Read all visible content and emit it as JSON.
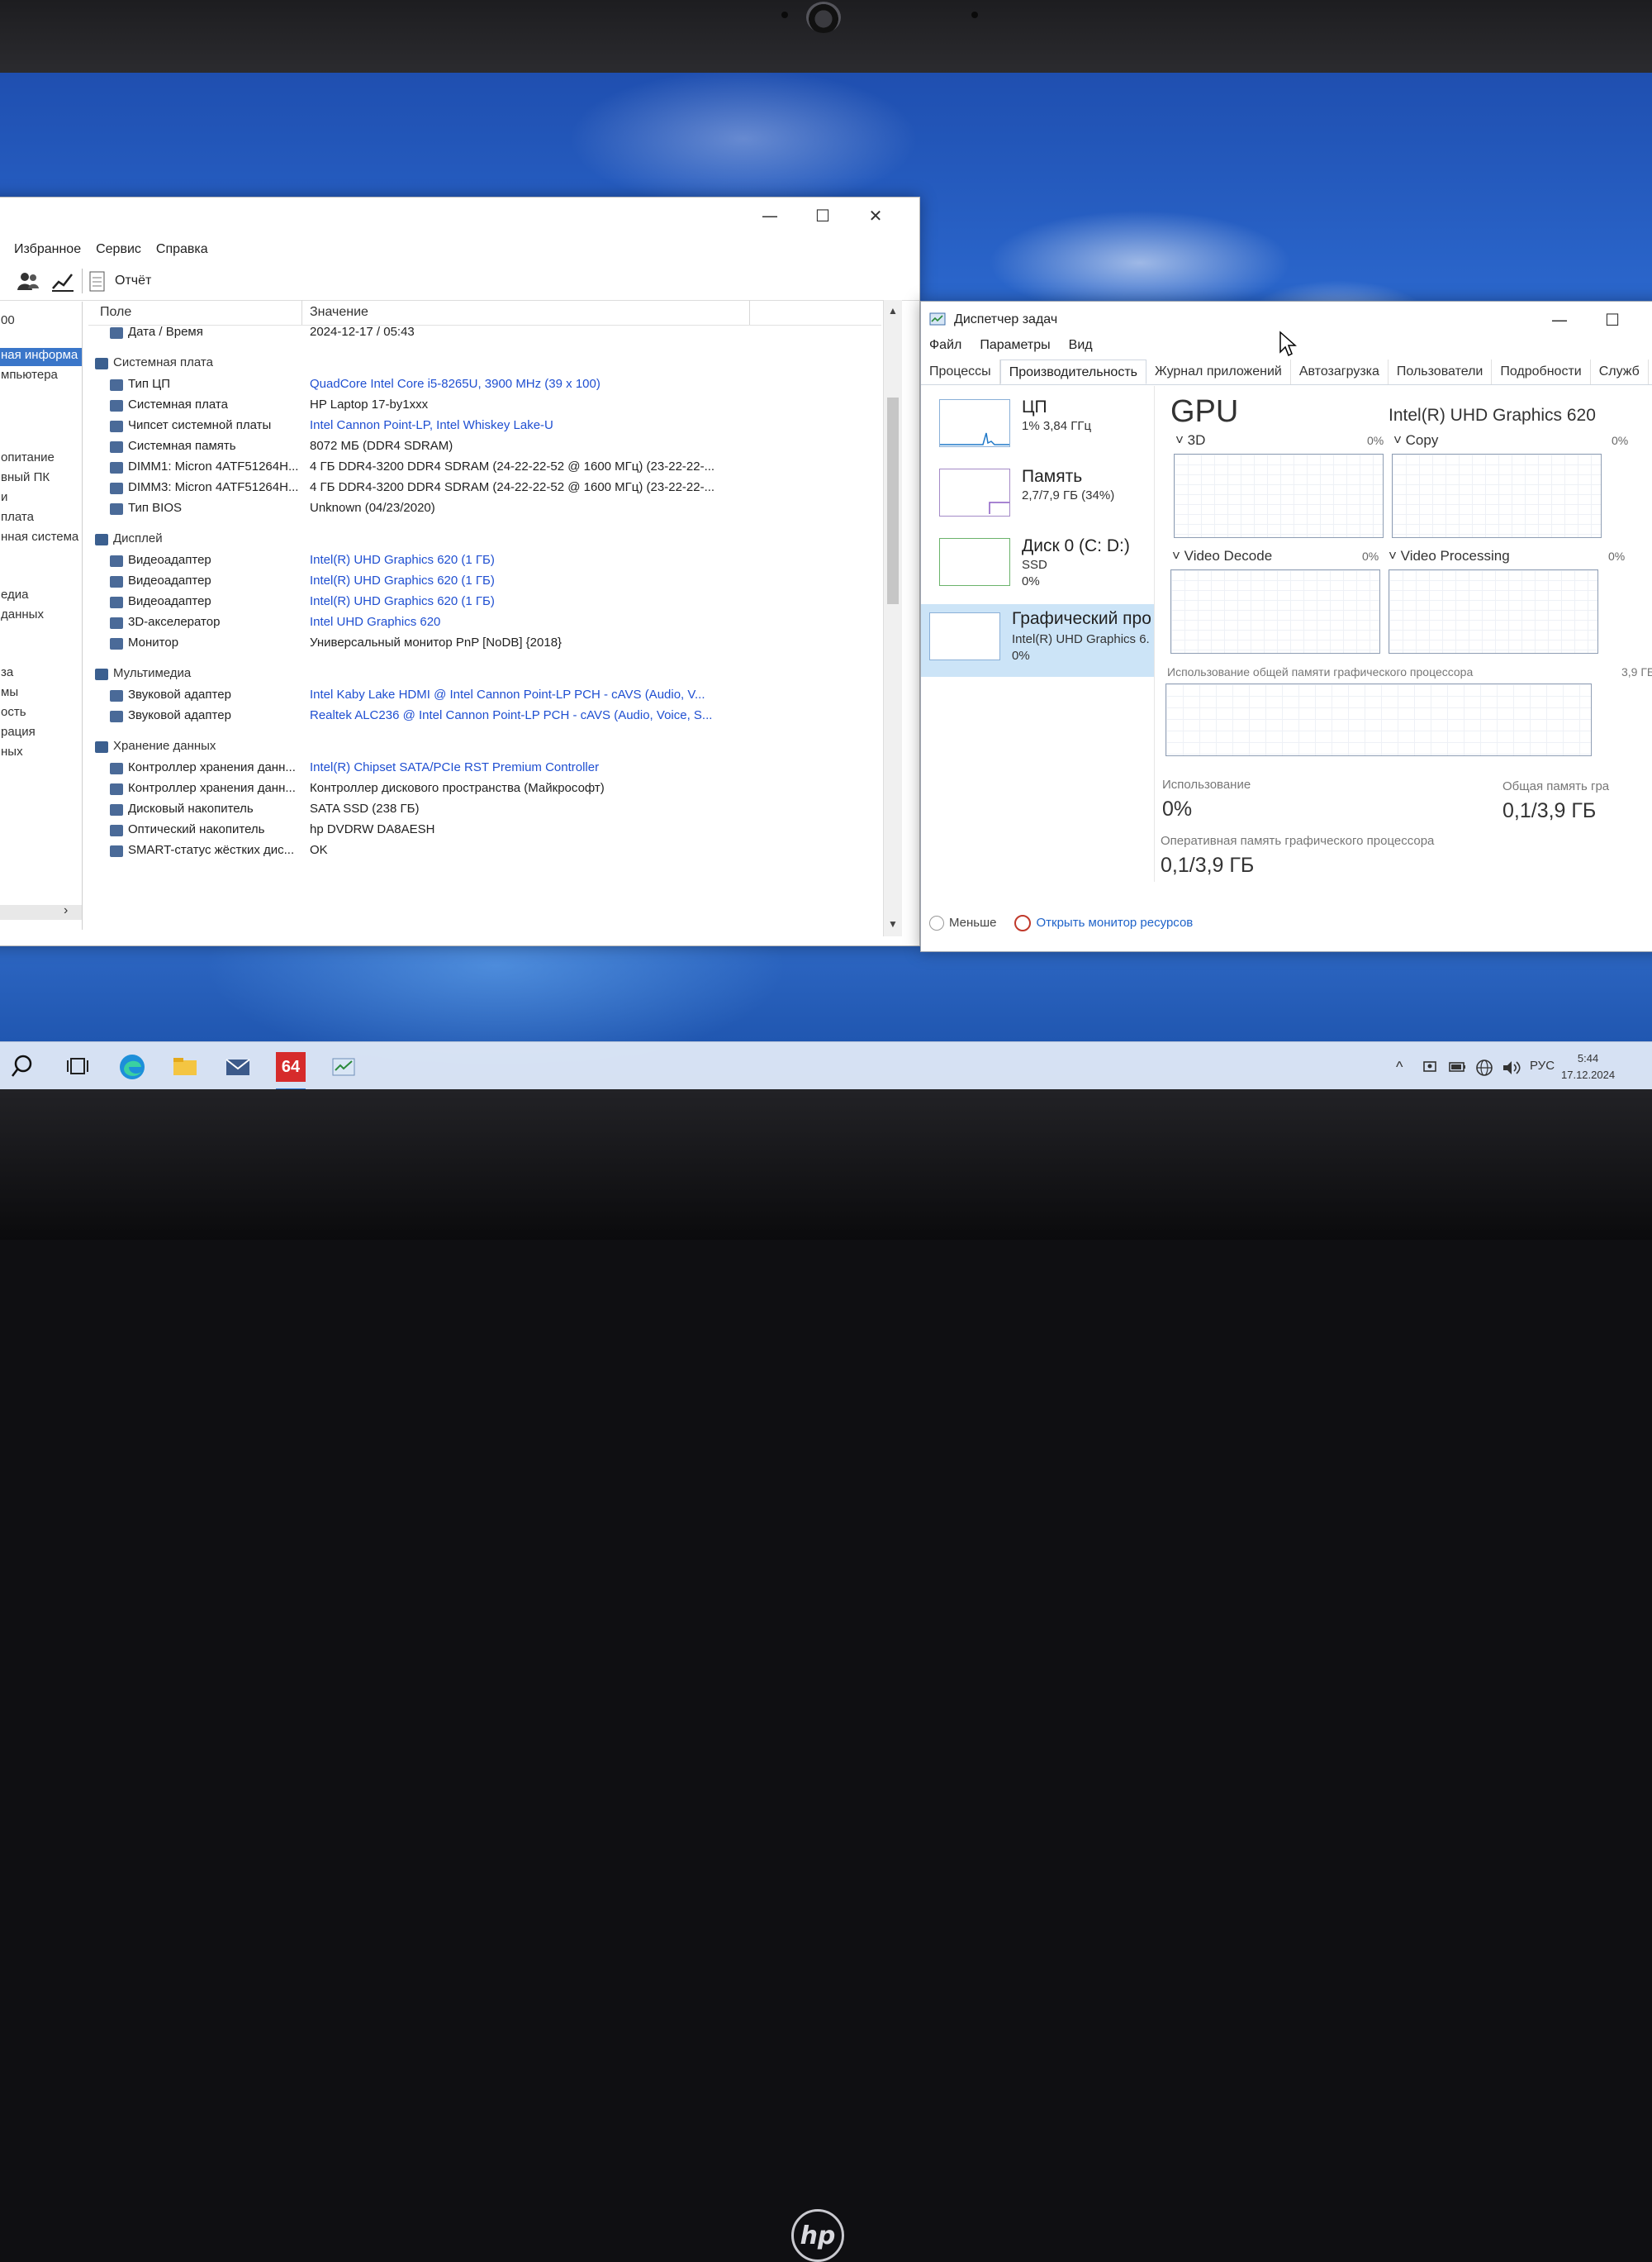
{
  "aida": {
    "menu": [
      "Избранное",
      "Сервис",
      "Справка"
    ],
    "toolbar_report": "Отчёт",
    "left_tree": [
      "00",
      "ная информа",
      "мпьютера",
      "опитание",
      "вный ПК",
      "и",
      "плата",
      "нная система",
      "едиа",
      "данных",
      "за",
      "мы",
      "ость",
      "рация",
      "ных"
    ],
    "col_field": "Поле",
    "col_value": "Значение",
    "rows": [
      {
        "f": "Дата / Время",
        "v": "2024-12-17 / 05:43",
        "type": "item",
        "link": false
      },
      {
        "f": "Системная плата",
        "v": "",
        "type": "group",
        "link": false
      },
      {
        "f": "Тип ЦП",
        "v": "QuadCore Intel Core i5-8265U, 3900 MHz (39 x 100)",
        "type": "item",
        "link": true
      },
      {
        "f": "Системная плата",
        "v": "HP Laptop 17-by1xxx",
        "type": "item",
        "link": false
      },
      {
        "f": "Чипсет системной платы",
        "v": "Intel Cannon Point-LP, Intel Whiskey Lake-U",
        "type": "item",
        "link": true
      },
      {
        "f": "Системная память",
        "v": "8072 МБ (DDR4 SDRAM)",
        "type": "item",
        "link": false
      },
      {
        "f": "DIMM1: Micron 4ATF51264H...",
        "v": "4 ГБ DDR4-3200 DDR4 SDRAM (24-22-22-52 @ 1600 МГц) (23-22-22-...",
        "type": "item",
        "link": false
      },
      {
        "f": "DIMM3: Micron 4ATF51264H...",
        "v": "4 ГБ DDR4-3200 DDR4 SDRAM (24-22-22-52 @ 1600 МГц) (23-22-22-...",
        "type": "item",
        "link": false
      },
      {
        "f": "Тип BIOS",
        "v": "Unknown (04/23/2020)",
        "type": "item",
        "link": false
      },
      {
        "f": "Дисплей",
        "v": "",
        "type": "group",
        "link": false
      },
      {
        "f": "Видеоадаптер",
        "v": "Intel(R) UHD Graphics 620 (1 ГБ)",
        "type": "item",
        "link": true
      },
      {
        "f": "Видеоадаптер",
        "v": "Intel(R) UHD Graphics 620 (1 ГБ)",
        "type": "item",
        "link": true
      },
      {
        "f": "Видеоадаптер",
        "v": "Intel(R) UHD Graphics 620 (1 ГБ)",
        "type": "item",
        "link": true
      },
      {
        "f": "3D-акселератор",
        "v": "Intel UHD Graphics 620",
        "type": "item",
        "link": true
      },
      {
        "f": "Монитор",
        "v": "Универсальный монитор PnP [NoDB] {2018}",
        "type": "item",
        "link": false
      },
      {
        "f": "Мультимедиа",
        "v": "",
        "type": "group",
        "link": false
      },
      {
        "f": "Звуковой адаптер",
        "v": "Intel Kaby Lake HDMI @ Intel Cannon Point-LP PCH - cAVS (Audio, V...",
        "type": "item",
        "link": true
      },
      {
        "f": "Звуковой адаптер",
        "v": "Realtek ALC236 @ Intel Cannon Point-LP PCH - cAVS (Audio, Voice, S...",
        "type": "item",
        "link": true
      },
      {
        "f": "Хранение данных",
        "v": "",
        "type": "group",
        "link": false
      },
      {
        "f": "Контроллер хранения данн...",
        "v": "Intel(R) Chipset SATA/PCIe RST Premium Controller",
        "type": "item",
        "link": true
      },
      {
        "f": "Контроллер хранения данн...",
        "v": "Контроллер дискового пространства (Майкрософт)",
        "type": "item",
        "link": false
      },
      {
        "f": "Дисковый накопитель",
        "v": "SATA SSD (238 ГБ)",
        "type": "item",
        "link": false
      },
      {
        "f": "Оптический накопитель",
        "v": "hp DVDRW DA8AESH",
        "type": "item",
        "link": false
      },
      {
        "f": "SMART-статус жёстких дис...",
        "v": "OK",
        "type": "item",
        "link": false
      }
    ]
  },
  "tm": {
    "title": "Диспетчер задач",
    "menu": [
      "Файл",
      "Параметры",
      "Вид"
    ],
    "tabs": [
      "Процессы",
      "Производительность",
      "Журнал приложений",
      "Автозагрузка",
      "Пользователи",
      "Подробности",
      "Служб"
    ],
    "active_tab": 1,
    "tiles": [
      {
        "name": "ЦП",
        "l2": "1% 3,84 ГГц",
        "l3": ""
      },
      {
        "name": "Память",
        "l2": "2,7/7,9 ГБ (34%)",
        "l3": ""
      },
      {
        "name": "Диск 0 (C: D:)",
        "l2": "SSD",
        "l3": "0%"
      },
      {
        "name": "Графический про",
        "l2": "Intel(R) UHD Graphics 6.",
        "l3": "0%"
      }
    ],
    "gpu_title": "GPU",
    "gpu_model": "Intel(R) UHD Graphics 620",
    "engines": [
      {
        "label": "3D",
        "pct": "0%"
      },
      {
        "label": "Copy",
        "pct": "0%"
      },
      {
        "label": "Video Decode",
        "pct": "0%"
      },
      {
        "label": "Video Processing",
        "pct": "0%"
      }
    ],
    "shared_label": "Использование общей памяти графического процессора",
    "shared_max": "3,9 ГБ",
    "usage_label": "Использование",
    "usage_value": "0%",
    "total_label": "Общая память гра",
    "total_value": "0,1/3,9 ГБ",
    "dedicated_label": "Оперативная память графического процессора",
    "dedicated_value": "0,1/3,9 ГБ",
    "less": "Меньше",
    "resmon": "Открыть монитор ресурсов"
  },
  "taskbar": {
    "lang": "РУС",
    "time": "5:44",
    "date": "17.12.2024",
    "app_badge": "64"
  },
  "brand": "hp"
}
